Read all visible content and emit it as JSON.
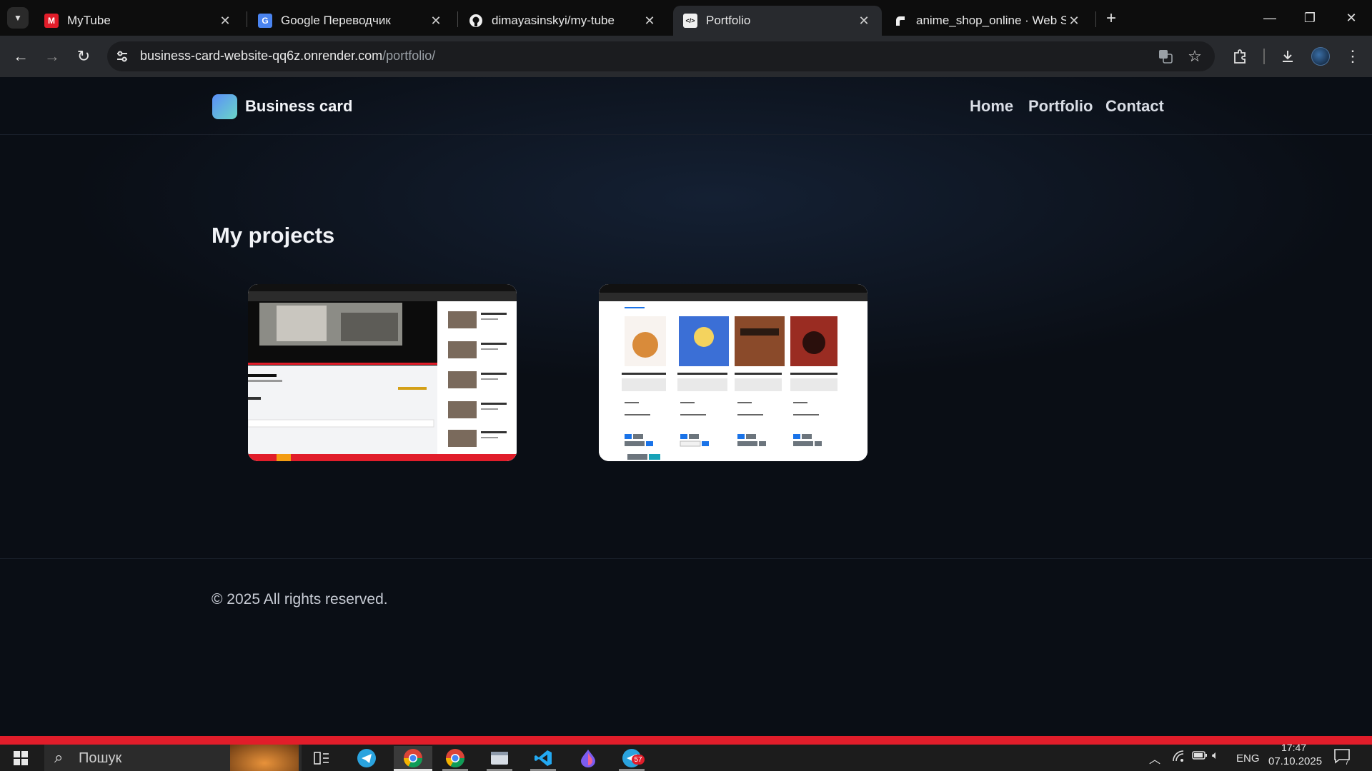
{
  "browser": {
    "tabs": [
      {
        "title": "MyTube",
        "favicon": "M"
      },
      {
        "title": "Google Переводчик",
        "favicon": "G"
      },
      {
        "title": "dimayasinskyi/my-tube",
        "favicon": "github"
      },
      {
        "title": "Portfolio",
        "favicon": "</>",
        "active": true
      },
      {
        "title": "anime_shop_online · Web Servi",
        "favicon": "render"
      }
    ],
    "url_host": "business-card-website-qq6z.onrender.com",
    "url_path": "/portfolio/"
  },
  "site": {
    "brand": "Business card",
    "nav": {
      "home": "Home",
      "portfolio": "Portfolio",
      "contact": "Contact"
    },
    "heading": "My projects",
    "footer": "© 2025 All rights reserved.",
    "accent_gradient": [
      "#5b8ff9",
      "#6ad6c6"
    ]
  },
  "projects": {
    "mytube": {
      "video_title": "Video 144",
      "sidebar_items": [
        "Sample Video 24",
        "Sample Video 11",
        "Sample Video 14",
        "Sample Video 15",
        "Sample Video 7"
      ]
    },
    "anime_shop": {
      "products": [
        {
          "name": "Naruto Uzumaki Figure",
          "color": "#d98b3a"
        },
        {
          "name": "Sailor Moon Eternal Edition Figure",
          "color": "#3b6fd6"
        },
        {
          "name": "Attack on Titan – Wall Maria Art Poster",
          "color": "#8a4a2a"
        },
        {
          "name": "Studio Ghibli – Spirited Away Art Print",
          "color": "#9a2c22"
        }
      ]
    }
  },
  "taskbar": {
    "search": "Пошук",
    "lang": "ENG",
    "time": "17:47",
    "date": "07.10.2025",
    "telegram_badge": "57",
    "notif_count": "7"
  }
}
